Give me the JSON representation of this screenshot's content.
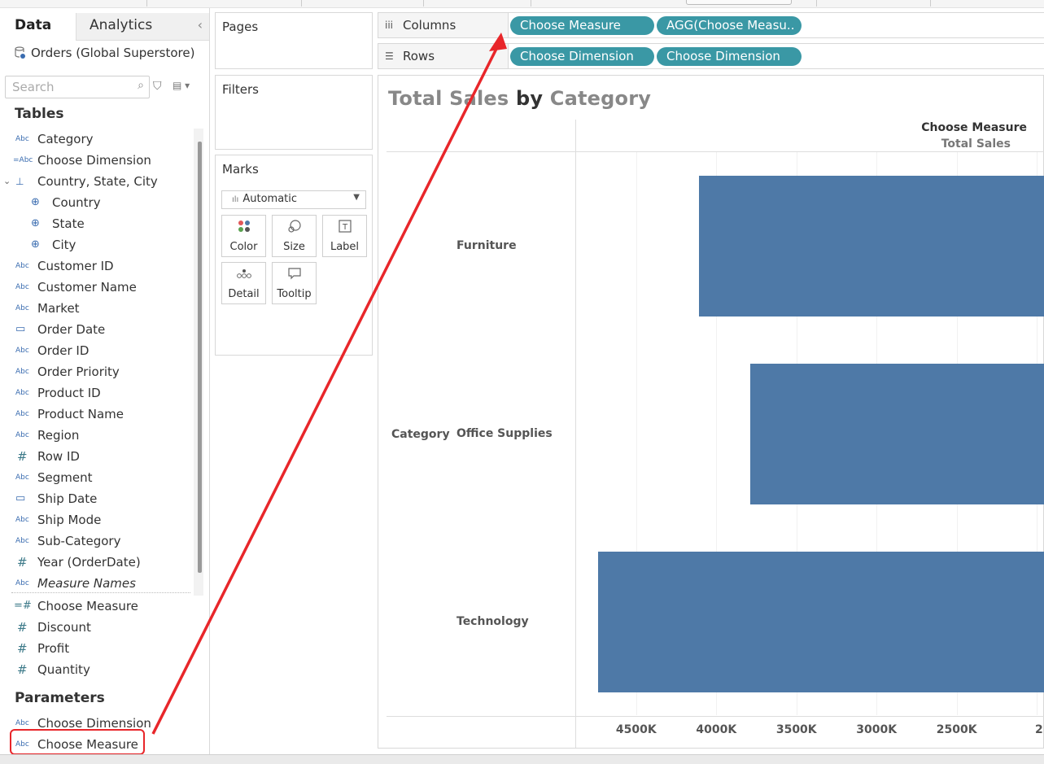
{
  "data_pane": {
    "tab_data": "Data",
    "tab_analytics": "Analytics",
    "datasource": "Orders (Global Superstore)",
    "search_placeholder": "Search",
    "tables_title": "Tables",
    "fields": [
      {
        "icon": "Abc",
        "label": "Category"
      },
      {
        "icon": "=Abc",
        "label": "Choose Dimension"
      },
      {
        "icon": "hierarchy-icon",
        "label": "Country, State, City"
      },
      {
        "icon": "globe-icon",
        "label": "Country"
      },
      {
        "icon": "globe-icon",
        "label": "State"
      },
      {
        "icon": "globe-icon",
        "label": "City"
      },
      {
        "icon": "Abc",
        "label": "Customer ID"
      },
      {
        "icon": "Abc",
        "label": "Customer Name"
      },
      {
        "icon": "Abc",
        "label": "Market"
      },
      {
        "icon": "calendar-icon",
        "label": "Order Date"
      },
      {
        "icon": "Abc",
        "label": "Order ID"
      },
      {
        "icon": "Abc",
        "label": "Order Priority"
      },
      {
        "icon": "Abc",
        "label": "Product ID"
      },
      {
        "icon": "Abc",
        "label": "Product Name"
      },
      {
        "icon": "Abc",
        "label": "Region"
      },
      {
        "icon": "#",
        "label": "Row ID"
      },
      {
        "icon": "Abc",
        "label": "Segment"
      },
      {
        "icon": "calendar-icon",
        "label": "Ship Date"
      },
      {
        "icon": "Abc",
        "label": "Ship Mode"
      },
      {
        "icon": "Abc",
        "label": "Sub-Category"
      },
      {
        "icon": "#",
        "label": "Year (OrderDate)"
      },
      {
        "icon": "Abc",
        "label": "Measure Names"
      },
      {
        "icon": "=#",
        "label": "Choose Measure"
      },
      {
        "icon": "#",
        "label": "Discount"
      },
      {
        "icon": "#",
        "label": "Profit"
      },
      {
        "icon": "#",
        "label": "Quantity"
      }
    ],
    "parameters_title": "Parameters",
    "parameters": [
      {
        "icon": "Abc",
        "label": "Choose Dimension"
      },
      {
        "icon": "Abc",
        "label": "Choose Measure"
      }
    ]
  },
  "cards": {
    "pages": "Pages",
    "filters": "Filters",
    "marks": "Marks",
    "mark_type": "Automatic",
    "mark_buttons": [
      "Color",
      "Size",
      "Label",
      "Detail",
      "Tooltip"
    ]
  },
  "shelves": {
    "columns_label": "Columns",
    "rows_label": "Rows",
    "column_pills": [
      "Choose Measure",
      "AGG(Choose Measu.."
    ],
    "row_pills": [
      "Choose Dimension",
      "Choose Dimension"
    ]
  },
  "view": {
    "title_part1": "Total Sales",
    "title_part2": "by",
    "title_part3": "Category",
    "header_top": "Choose Measure",
    "header_sub": "Total Sales",
    "row_header": "Category"
  },
  "chart_data": {
    "type": "bar",
    "orientation": "horizontal",
    "axis_reversed": true,
    "categories": [
      "Furniture",
      "Office Supplies",
      "Technology"
    ],
    "values": [
      4110000,
      3790000,
      4740000
    ],
    "xlim": [
      1950000,
      4880000
    ],
    "x_ticks": [
      "4500K",
      "4000K",
      "3500K",
      "3000K",
      "2500K",
      "2"
    ],
    "x_tick_values": [
      4500000,
      4000000,
      3500000,
      3000000,
      2500000,
      2000000
    ],
    "bar_color": "#4e79a7"
  }
}
